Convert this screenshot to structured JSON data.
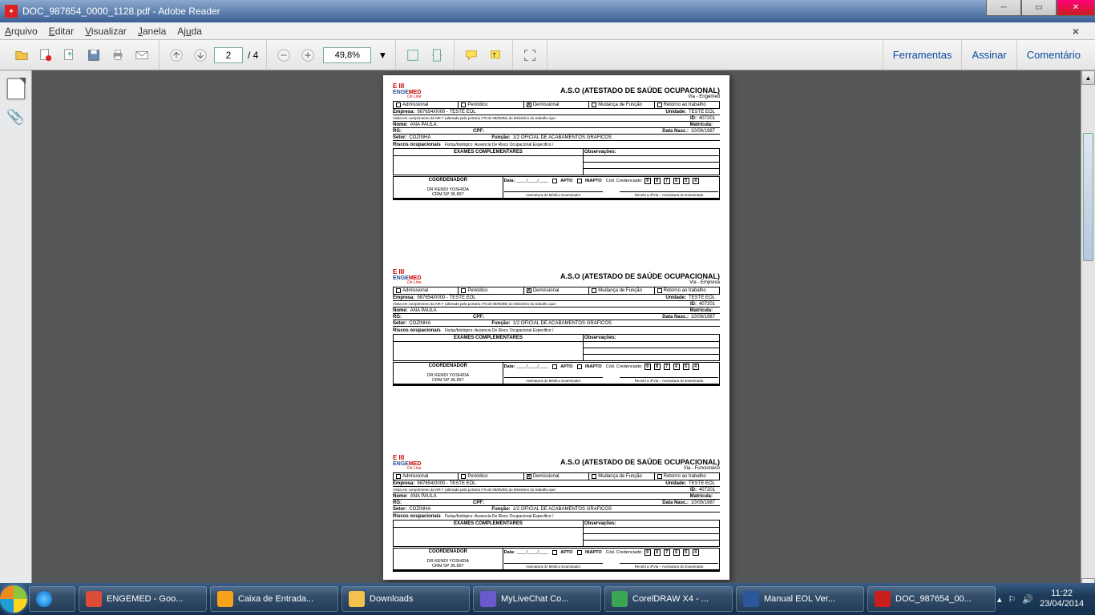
{
  "window": {
    "filename": "DOC_987654_0000_1128.pdf",
    "app": "Adobe Reader"
  },
  "menu": {
    "arquivo": "Arquivo",
    "editar": "Editar",
    "visualizar": "Visualizar",
    "janela": "Janela",
    "ajuda": "Ajuda"
  },
  "toolbar": {
    "page_current": "2",
    "page_total": "/ 4",
    "zoom": "49,8%",
    "ferramentas": "Ferramentas",
    "assinar": "Assinar",
    "comentario": "Comentário"
  },
  "aso": {
    "title": "A.S.O (ATESTADO DE SAÚDE OCUPACIONAL)",
    "via": [
      "Via - Engemed",
      "Via - Empresa",
      "Via - Funcionário"
    ],
    "logo_e": "E III",
    "logo_brand_b": "ENGE",
    "logo_brand_r": "MED",
    "logo_sub": "On Line",
    "types": {
      "admissional": "Admissional",
      "periodico": "Periódico",
      "demissional": "Demissional",
      "mudanca": "Mudança de Função",
      "retorno": "Retorno ao trabalho"
    },
    "labels": {
      "empresa": "Empresa:",
      "unidade": "Unidade:",
      "id": "ID:",
      "nome": "Nome:",
      "matricula": "Matrícula:",
      "rg": "RG:",
      "cpf": "CPF:",
      "datanasc": "Data Nasc.:",
      "setor": "Setor:",
      "funcao": "Função:",
      "riscos": "Riscos ocupacionais",
      "riscos_desc": "Fis/qu/biológico: Ausencia De Risco Ocupacional Especifico /",
      "exames": "EXAMES COMPLEMENTARES",
      "obs": "Observações:",
      "coordenador": "COORDENADOR",
      "data": "Data:",
      "apto": "APTO",
      "inapto": "INAPTO",
      "cred": "Cód. Credenciado:",
      "sign1": "Assinatura do Médico Examinador",
      "sign2": "Recebi a 3ªVia – Assinatura do Examinado",
      "nr": "Visita em cumprimento da NR-7 (alterada pela portaria nº8 de 08/05/96) do Ministério do trabalho que:"
    },
    "values": {
      "empresa": "987654/0000 - TESTE EOL",
      "unidade": "TESTE EOL",
      "id": "407201",
      "nome": "ANA PAULA",
      "matricula": "",
      "rg": "",
      "cpf": "",
      "datanasc": "10/08/1987",
      "setor": "COZINHA",
      "funcao": "1/2 OFICIAL DE ACABAMENTOS GRAFICOS",
      "coord_dr": "DR KENDI YOSHIDA",
      "coord_crm": "CRM SP   36.897",
      "date_blank": "____/____/____",
      "cred_digits": [
        "9",
        "8",
        "7",
        "6",
        "5",
        "4"
      ]
    }
  },
  "taskbar": {
    "items": [
      {
        "label": "ENGEMED - Goo...",
        "color": "#dd4b39"
      },
      {
        "label": "Caixa de Entrada...",
        "color": "#f7a11b"
      },
      {
        "label": "Downloads",
        "color": "#f2c14e"
      },
      {
        "label": "MyLiveChat Co...",
        "color": "#6a5acd"
      },
      {
        "label": "CorelDRAW X4 - ...",
        "color": "#3aa655"
      },
      {
        "label": "Manual EOL Ver...",
        "color": "#2b579a"
      },
      {
        "label": "DOC_987654_00...",
        "color": "#c81e1e"
      }
    ],
    "time": "11:22",
    "date": "23/04/2014"
  }
}
